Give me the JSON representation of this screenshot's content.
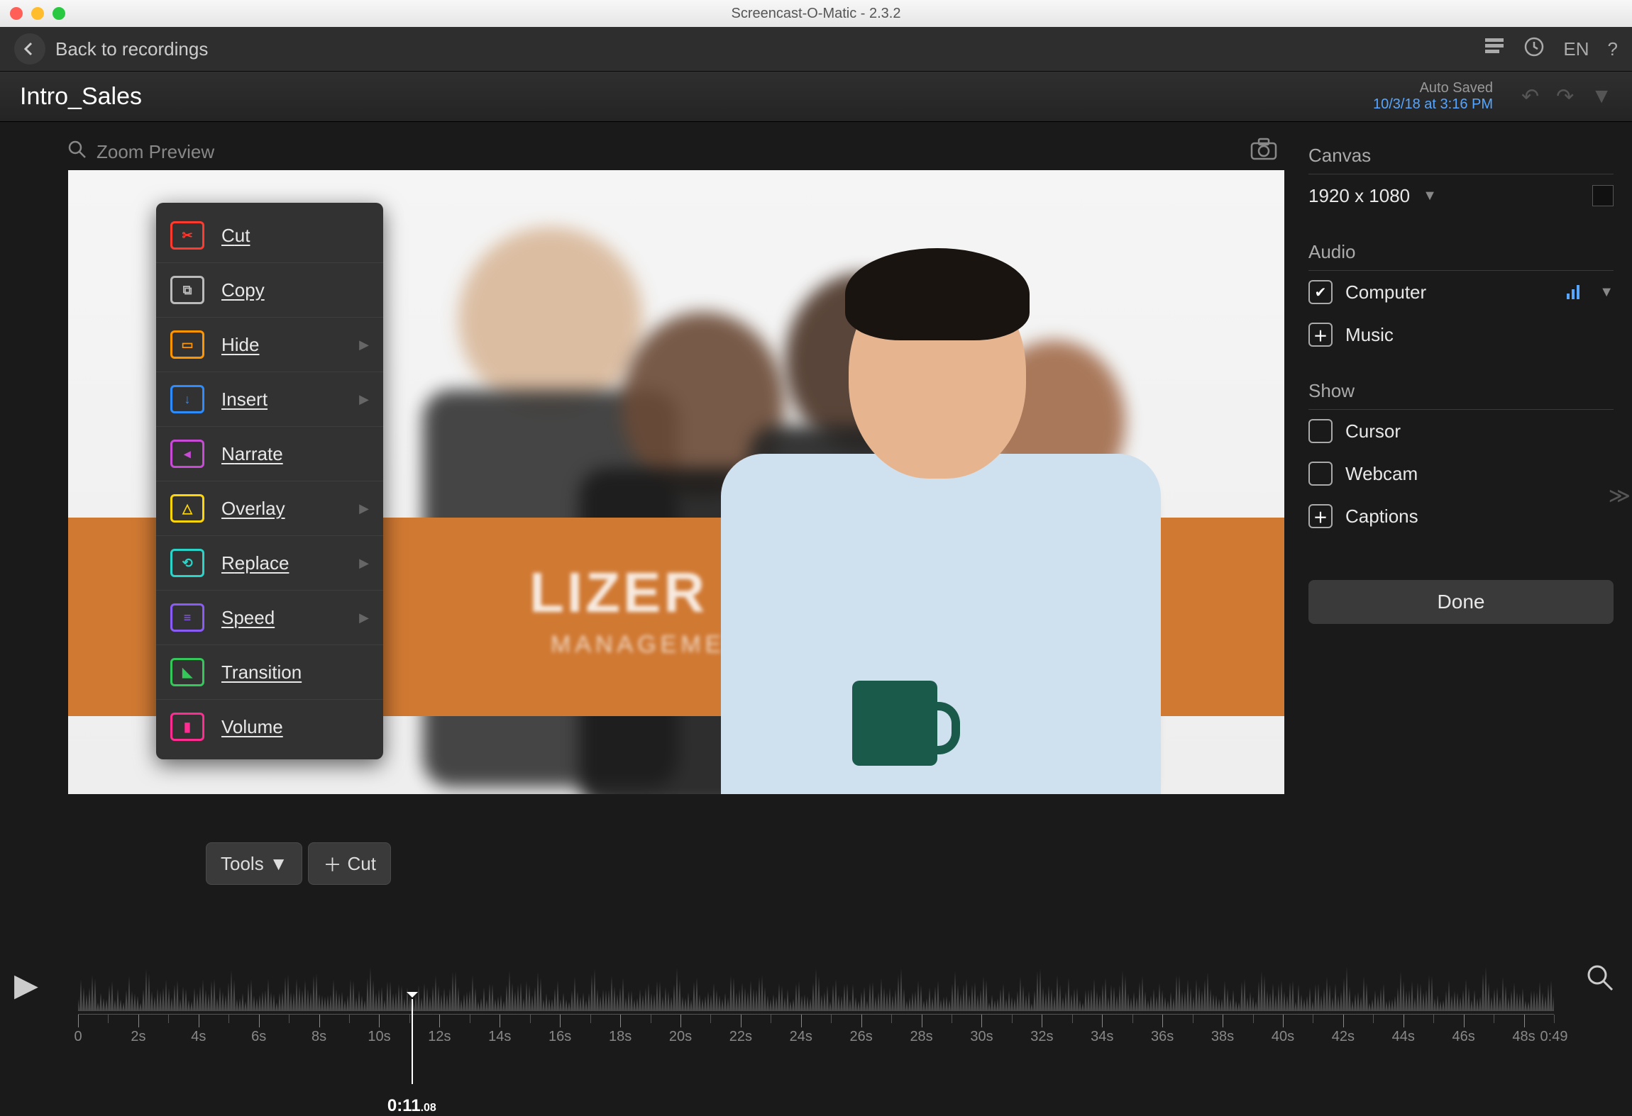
{
  "window": {
    "title": "Screencast-O-Matic - 2.3.2"
  },
  "header": {
    "back_label": "Back to recordings",
    "lang": "EN"
  },
  "project": {
    "name": "Intro_Sales",
    "autosave_label": "Auto Saved",
    "autosave_time": "10/3/18 at 3:16 PM"
  },
  "preview": {
    "zoom_label": "Zoom Preview",
    "banner_main": "LIZER",
    "banner_sub": "MANAGEMENT"
  },
  "tools_menu": {
    "items": [
      {
        "label": "Cut",
        "color": "#ff3b30",
        "submenu": false,
        "glyph": "✂"
      },
      {
        "label": "Copy",
        "color": "#bbbbbb",
        "submenu": false,
        "glyph": "⧉"
      },
      {
        "label": "Hide",
        "color": "#ff9500",
        "submenu": true,
        "glyph": "▭"
      },
      {
        "label": "Insert",
        "color": "#2d8cff",
        "submenu": true,
        "glyph": "↓"
      },
      {
        "label": "Narrate",
        "color": "#c84bd6",
        "submenu": false,
        "glyph": "◂"
      },
      {
        "label": "Overlay",
        "color": "#ffd60a",
        "submenu": true,
        "glyph": "△"
      },
      {
        "label": "Replace",
        "color": "#2ad4c9",
        "submenu": true,
        "glyph": "⟲"
      },
      {
        "label": "Speed",
        "color": "#8a5cf6",
        "submenu": true,
        "glyph": "≡"
      },
      {
        "label": "Transition",
        "color": "#34c759",
        "submenu": false,
        "glyph": "◣"
      },
      {
        "label": "Volume",
        "color": "#ff2d92",
        "submenu": false,
        "glyph": "▮"
      }
    ]
  },
  "toolbar": {
    "tools_label": "Tools",
    "cut_label": "Cut"
  },
  "side": {
    "canvas_title": "Canvas",
    "canvas_size": "1920 x 1080",
    "audio_title": "Audio",
    "audio_computer": "Computer",
    "audio_music": "Music",
    "show_title": "Show",
    "show_cursor": "Cursor",
    "show_webcam": "Webcam",
    "show_captions": "Captions",
    "done_label": "Done"
  },
  "timeline": {
    "cursor_time": "0:11",
    "cursor_ms": ".08",
    "end_label": "0:49",
    "ticks": [
      "0",
      "2s",
      "4s",
      "6s",
      "8s",
      "10s",
      "12s",
      "14s",
      "16s",
      "18s",
      "20s",
      "22s",
      "24s",
      "26s",
      "28s",
      "30s",
      "32s",
      "34s",
      "36s",
      "38s",
      "40s",
      "42s",
      "44s",
      "46s",
      "48s"
    ]
  }
}
